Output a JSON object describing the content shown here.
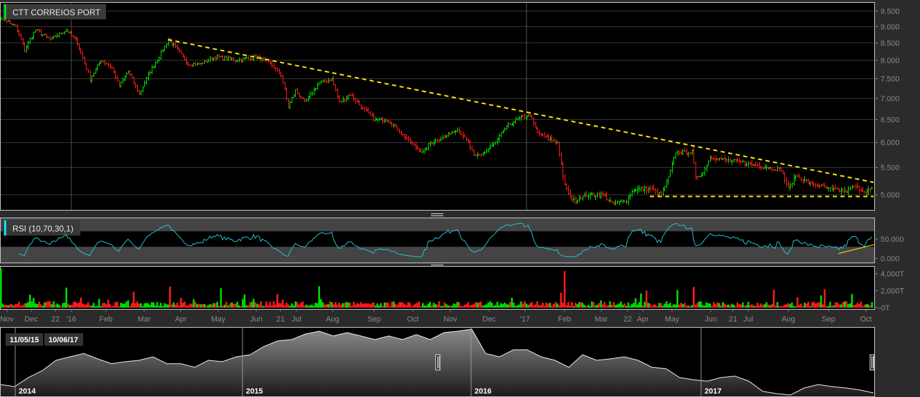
{
  "colors": {
    "up": "#00dd00",
    "down": "#ff1a1a",
    "trend": "#ffee00",
    "rsi": "#22c4d4",
    "accent_main": "#00dd00",
    "accent_rsi": "#00e5ff"
  },
  "main_panel": {
    "title": "CTT CORREIOS PORT"
  },
  "rsi_panel": {
    "title": "RSI (10,70,30,1)"
  },
  "chart_data": [
    {
      "type": "ohlc",
      "title": "CTT CORREIOS PORT",
      "scale": "log",
      "ylim": [
        4.75,
        9.75
      ],
      "yticks": [
        "9.500",
        "9.000",
        "8.500",
        "8.000",
        "7.500",
        "7.000",
        "6.500",
        "6.000",
        "5.500",
        "5.000"
      ],
      "ytick_values": [
        9.5,
        9.0,
        8.5,
        8.0,
        7.5,
        7.0,
        6.5,
        6.0,
        5.5,
        5.0
      ],
      "x_range_days": [
        0,
        480
      ],
      "xticks": [
        "Nov",
        "Dec",
        "22",
        "'16",
        "Feb",
        "Mar",
        "Apr",
        "May",
        "Jun",
        "21",
        "Jul",
        "Aug",
        "Sep",
        "Oct",
        "Nov",
        "Dec",
        "'17",
        "Feb",
        "Mar",
        "22",
        "Apr",
        "May",
        "Jun",
        "21",
        "Jul",
        "Aug",
        "Sep",
        "Oct"
      ],
      "close_keypoints": [
        [
          0,
          9.3
        ],
        [
          8,
          9.0
        ],
        [
          13,
          8.3
        ],
        [
          19,
          8.9
        ],
        [
          27,
          8.6
        ],
        [
          36,
          8.9
        ],
        [
          42,
          8.5
        ],
        [
          49,
          7.5
        ],
        [
          55,
          8.0
        ],
        [
          61,
          7.8
        ],
        [
          65,
          7.3
        ],
        [
          70,
          7.7
        ],
        [
          76,
          7.1
        ],
        [
          82,
          7.7
        ],
        [
          87,
          8.1
        ],
        [
          92,
          8.6
        ],
        [
          97,
          8.3
        ],
        [
          103,
          7.9
        ],
        [
          110,
          7.9
        ],
        [
          118,
          8.1
        ],
        [
          129,
          8.0
        ],
        [
          141,
          8.1
        ],
        [
          148,
          7.9
        ],
        [
          154,
          7.6
        ],
        [
          158,
          6.8
        ],
        [
          162,
          7.2
        ],
        [
          167,
          6.9
        ],
        [
          175,
          7.4
        ],
        [
          182,
          7.5
        ],
        [
          186,
          6.9
        ],
        [
          192,
          7.1
        ],
        [
          198,
          6.8
        ],
        [
          205,
          6.5
        ],
        [
          213,
          6.5
        ],
        [
          220,
          6.2
        ],
        [
          228,
          5.9
        ],
        [
          232,
          5.8
        ],
        [
          236,
          6.0
        ],
        [
          243,
          6.1
        ],
        [
          251,
          6.3
        ],
        [
          257,
          6.0
        ],
        [
          260,
          5.7
        ],
        [
          266,
          5.8
        ],
        [
          272,
          6.0
        ],
        [
          277,
          6.3
        ],
        [
          283,
          6.5
        ],
        [
          291,
          6.6
        ],
        [
          295,
          6.2
        ],
        [
          300,
          6.1
        ],
        [
          306,
          6.0
        ],
        [
          309,
          5.3
        ],
        [
          312,
          5.0
        ],
        [
          315,
          4.9
        ],
        [
          323,
          5.0
        ],
        [
          331,
          5.0
        ],
        [
          336,
          4.85
        ],
        [
          344,
          4.9
        ],
        [
          348,
          5.1
        ],
        [
          357,
          5.1
        ],
        [
          363,
          5.0
        ],
        [
          367,
          5.3
        ],
        [
          371,
          5.8
        ],
        [
          376,
          5.8
        ],
        [
          380,
          5.8
        ],
        [
          382,
          5.3
        ],
        [
          386,
          5.4
        ],
        [
          390,
          5.7
        ],
        [
          397,
          5.65
        ],
        [
          407,
          5.6
        ],
        [
          414,
          5.55
        ],
        [
          422,
          5.5
        ],
        [
          429,
          5.45
        ],
        [
          433,
          5.1
        ],
        [
          437,
          5.35
        ],
        [
          445,
          5.2
        ],
        [
          456,
          5.1
        ],
        [
          464,
          5.05
        ],
        [
          469,
          5.15
        ],
        [
          475,
          5.05
        ],
        [
          479,
          5.1
        ]
      ],
      "trendlines": [
        {
          "name": "resistance",
          "from": [
            92,
            8.6
          ],
          "to": [
            480,
            5.22
          ],
          "style": "dashed"
        },
        {
          "name": "support",
          "from": [
            357,
            4.97
          ],
          "to": [
            480,
            4.97
          ],
          "style": "dashed"
        }
      ]
    },
    {
      "type": "line",
      "title": "RSI (10,70,30,1)",
      "period": 10,
      "overbought": 70,
      "oversold": 30,
      "ylim": [
        0,
        100
      ],
      "yticks": [
        "50.000",
        "0.000"
      ],
      "ytick_values": [
        50,
        0
      ]
    },
    {
      "type": "bar",
      "title": "Volume",
      "ylim": [
        0,
        4800
      ],
      "yticks": [
        "4,000T",
        "2,000T",
        "-0T"
      ],
      "ytick_values": [
        4000,
        2000,
        0
      ]
    },
    {
      "type": "area",
      "title": "Navigator",
      "year_labels": [
        "2014",
        "2015",
        "2016",
        "2017"
      ],
      "values": [
        5.66,
        5.51,
        6.17,
        6.67,
        7.43,
        7.68,
        7.93,
        7.53,
        7.18,
        7.33,
        7.43,
        7.68,
        7.18,
        7.18,
        6.92,
        7.43,
        7.33,
        7.68,
        7.83,
        8.44,
        8.84,
        8.94,
        9.35,
        9.55,
        9.2,
        9.45,
        9.2,
        8.94,
        9.2,
        8.94,
        9.3,
        8.94,
        9.45,
        9.55,
        9.7,
        7.93,
        7.68,
        8.19,
        8.19,
        7.68,
        7.43,
        6.92,
        7.83,
        7.43,
        7.53,
        7.68,
        7.43,
        6.92,
        6.82,
        6.17,
        6.01,
        5.91,
        6.17,
        6.27,
        5.91,
        5.16,
        5.0,
        4.9,
        5.41,
        5.66,
        5.51,
        5.41,
        5.26,
        5.05
      ],
      "range_start": "11/05/15",
      "range_end": "10/06/17"
    }
  ]
}
